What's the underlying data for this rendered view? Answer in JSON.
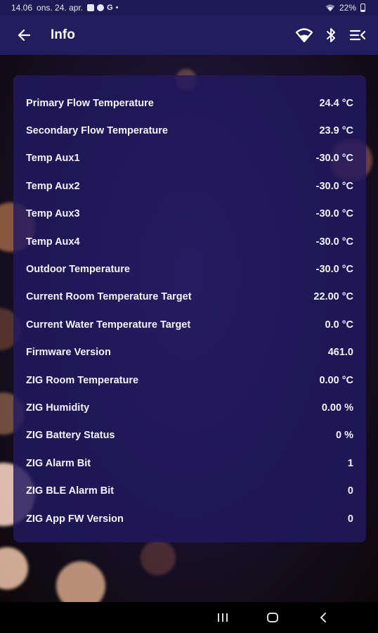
{
  "status_bar": {
    "time": "14.06",
    "date": "ons. 24. apr.",
    "notification_g": "G",
    "notification_dot": "•",
    "battery": "22%"
  },
  "app_bar": {
    "title": "Info",
    "icons": [
      "back-arrow-icon",
      "wifi-icon",
      "bluetooth-icon",
      "menu-list-icon"
    ]
  },
  "info_rows": [
    {
      "label": "Primary Flow Temperature",
      "value": "24.4 °C"
    },
    {
      "label": "Secondary Flow Temperature",
      "value": "23.9 °C"
    },
    {
      "label": "Temp Aux1",
      "value": "-30.0 °C"
    },
    {
      "label": "Temp Aux2",
      "value": "-30.0 °C"
    },
    {
      "label": "Temp Aux3",
      "value": "-30.0 °C"
    },
    {
      "label": "Temp Aux4",
      "value": "-30.0 °C"
    },
    {
      "label": "Outdoor Temperature",
      "value": "-30.0 °C"
    },
    {
      "label": "Current Room Temperature Target",
      "value": "22.00 °C"
    },
    {
      "label": "Current Water Temperature Target",
      "value": "0.0 °C"
    },
    {
      "label": "Firmware Version",
      "value": "461.0"
    },
    {
      "label": "ZIG Room Temperature",
      "value": "0.00 °C"
    },
    {
      "label": "ZIG Humidity",
      "value": "0.00 %"
    },
    {
      "label": "ZIG Battery Status",
      "value": "0 %"
    },
    {
      "label": "ZIG Alarm Bit",
      "value": "1"
    },
    {
      "label": "ZIG BLE Alarm Bit",
      "value": "0"
    },
    {
      "label": "ZIG App FW Version",
      "value": "0"
    }
  ],
  "nav_bar": {
    "icons": [
      "recent-apps-icon",
      "home-icon",
      "back-nav-icon"
    ]
  },
  "colors": {
    "status_bar": "#1d1a55",
    "app_bar": "#221e5e",
    "card": "#221860"
  }
}
